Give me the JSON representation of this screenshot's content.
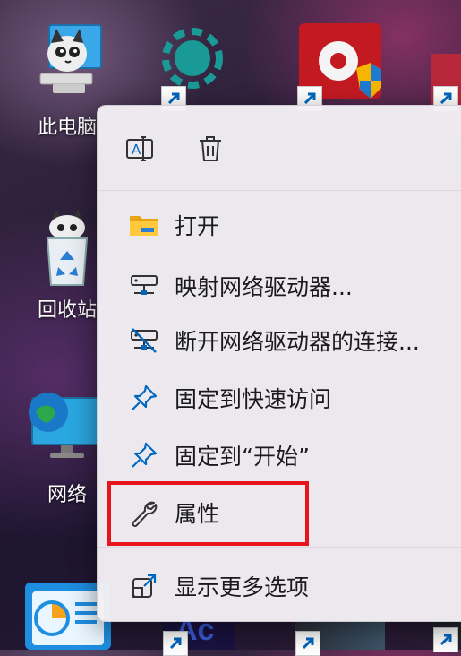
{
  "desktop": {
    "icons": [
      {
        "name": "this-pc",
        "label": "此电脑"
      },
      {
        "name": "recycle-bin",
        "label": "回收站"
      },
      {
        "name": "network",
        "label": "网络"
      }
    ],
    "top_partial_labels": [
      "",
      "",
      ""
    ],
    "bottom_partial_text": "Ac"
  },
  "context_menu": {
    "top_actions": [
      {
        "icon": "rename-icon",
        "tooltip": "重命名"
      },
      {
        "icon": "delete-icon",
        "tooltip": "删除"
      }
    ],
    "items": [
      {
        "icon": "folder-icon",
        "label": "打开"
      },
      {
        "icon": "map-network-drive-icon",
        "label": "映射网络驱动器..."
      },
      {
        "icon": "disconnect-network-drive-icon",
        "label": "断开网络驱动器的连接..."
      },
      {
        "icon": "pin-icon",
        "label": "固定到快速访问"
      },
      {
        "icon": "pin-icon",
        "label": "固定到“开始”"
      },
      {
        "icon": "wrench-icon",
        "label": "属性"
      },
      {
        "icon": "show-more-icon",
        "label": "显示更多选项"
      }
    ],
    "highlighted_item": "属性"
  },
  "colors": {
    "highlight_border": "#e8141b",
    "menu_bg": "#f3f0f4",
    "accent": "#0067c0"
  }
}
